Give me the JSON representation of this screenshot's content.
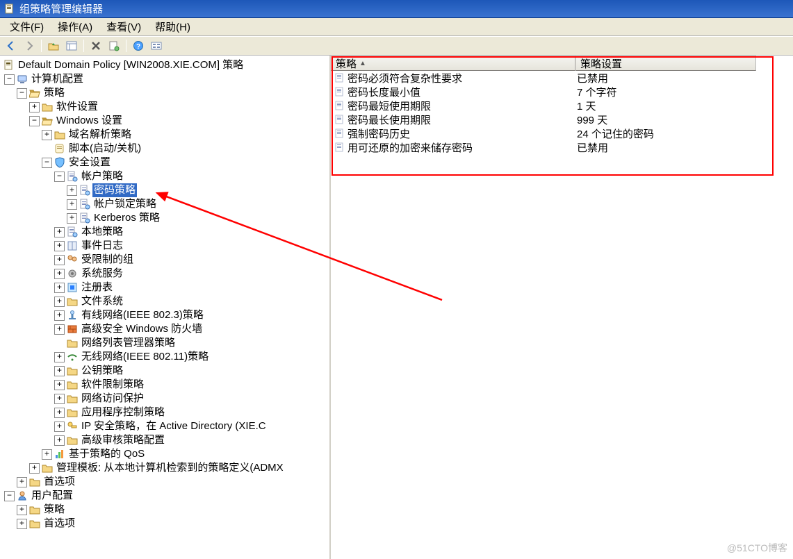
{
  "window": {
    "title": "组策略管理编辑器"
  },
  "watermark": "@51CTO博客",
  "menu": {
    "file": "文件(F)",
    "action": "操作(A)",
    "view": "查看(V)",
    "help": "帮助(H)"
  },
  "tree": {
    "root": "Default Domain Policy [WIN2008.XIE.COM] 策略",
    "computer_config": "计算机配置",
    "policy": "策略",
    "software_settings": "软件设置",
    "windows_settings": "Windows 设置",
    "name_res_policy": "域名解析策略",
    "scripts": "脚本(启动/关机)",
    "security_settings": "安全设置",
    "account_policies": "帐户策略",
    "password_policy": "密码策略",
    "account_lockout": "帐户锁定策略",
    "kerberos_policy": "Kerberos 策略",
    "local_policies": "本地策略",
    "event_log": "事件日志",
    "restricted_groups": "受限制的组",
    "system_services": "系统服务",
    "registry": "注册表",
    "file_system": "文件系统",
    "wired_network": "有线网络(IEEE 802.3)策略",
    "windows_firewall": "高级安全 Windows 防火墙",
    "network_list_mgr": "网络列表管理器策略",
    "wireless_network": "无线网络(IEEE 802.11)策略",
    "public_key": "公钥策略",
    "software_restriction": "软件限制策略",
    "nap": "网络访问保护",
    "app_control": "应用程序控制策略",
    "ipsec": "IP 安全策略，在 Active Directory (XIE.C",
    "adv_audit": "高级审核策略配置",
    "policy_qos": "基于策略的 QoS",
    "admin_templates": "管理模板: 从本地计算机检索到的策略定义(ADMX",
    "pref1": "首选项",
    "user_config": "用户配置",
    "user_policy": "策略",
    "user_pref": "首选项"
  },
  "list": {
    "col1": "策略",
    "col2": "策略设置",
    "rows": [
      {
        "policy": "密码必须符合复杂性要求",
        "setting": "已禁用"
      },
      {
        "policy": "密码长度最小值",
        "setting": "7 个字符"
      },
      {
        "policy": "密码最短使用期限",
        "setting": "1 天"
      },
      {
        "policy": "密码最长使用期限",
        "setting": "999 天"
      },
      {
        "policy": "强制密码历史",
        "setting": "24 个记住的密码"
      },
      {
        "policy": "用可还原的加密来储存密码",
        "setting": "已禁用"
      }
    ]
  }
}
